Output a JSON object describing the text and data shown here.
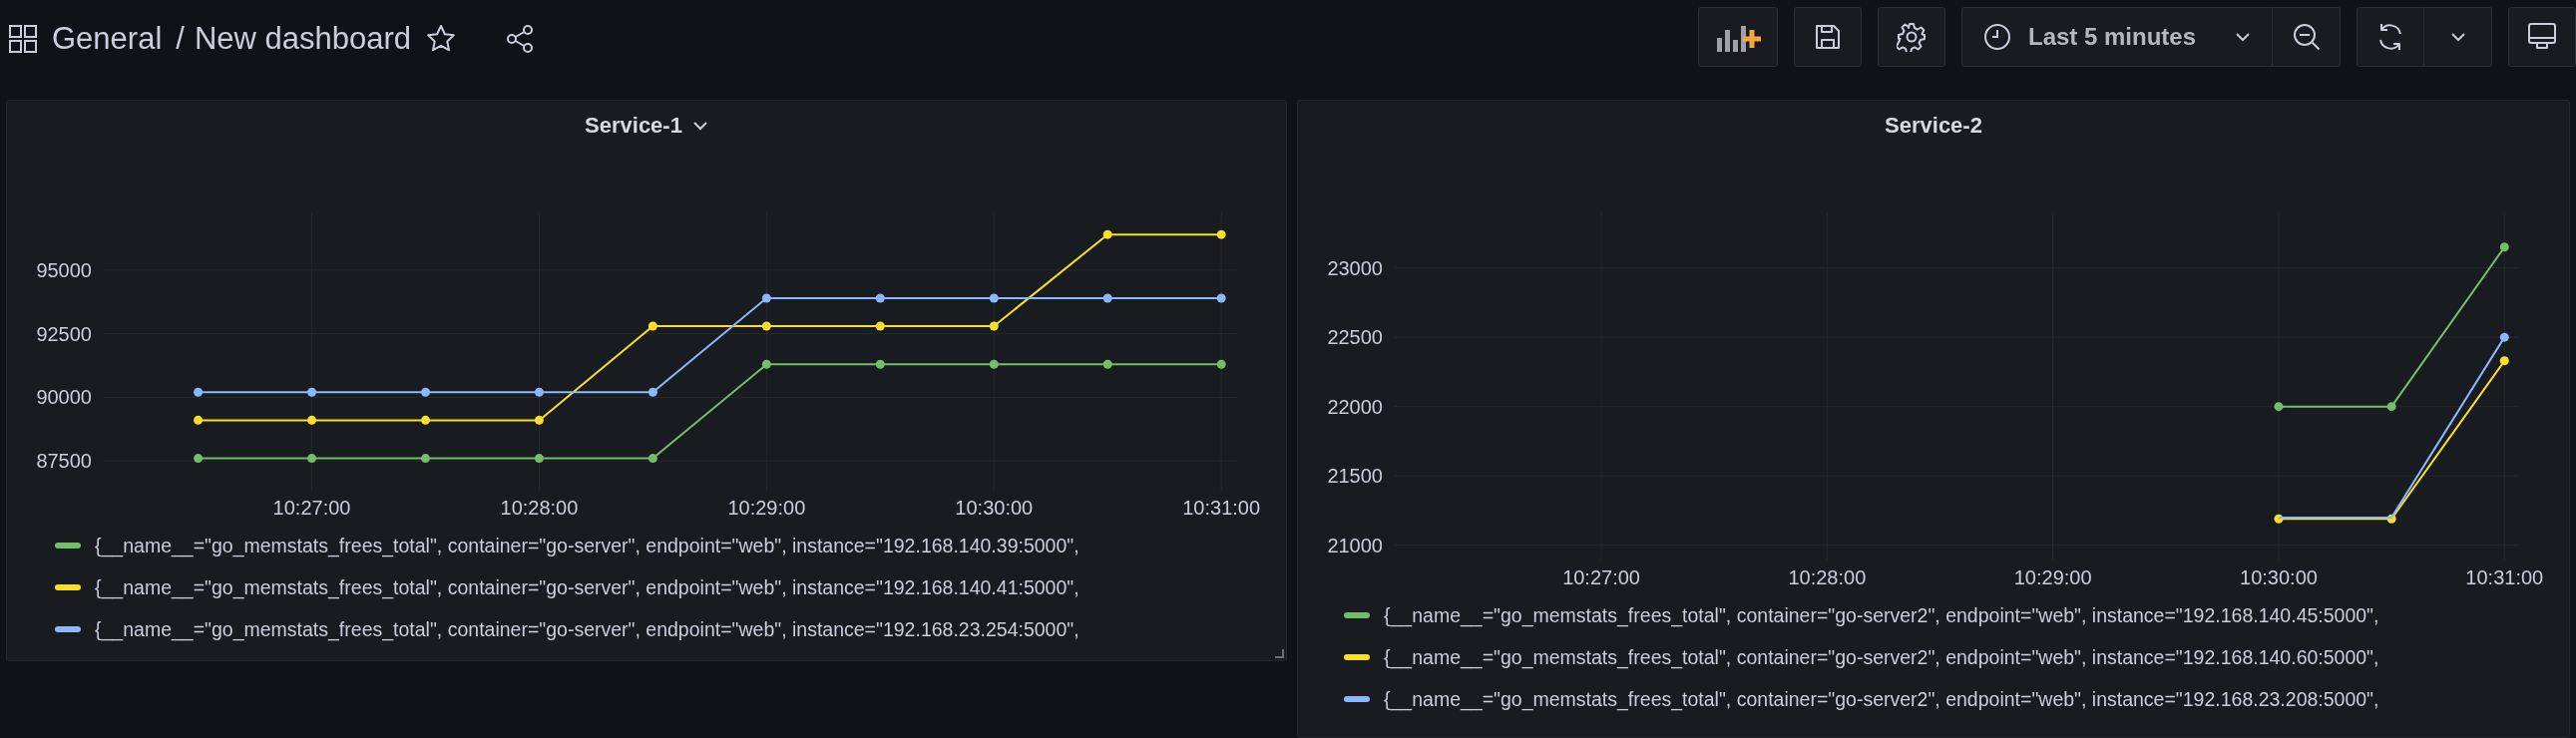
{
  "toolbar": {
    "folder": "General",
    "separator": "/",
    "title": "New dashboard",
    "starred": false,
    "time_range": "Last 5 minutes"
  },
  "panels": [
    {
      "title": "Service-1",
      "has_menu": true,
      "resizable": true,
      "chart_data": {
        "type": "line",
        "categories": [
          null,
          "10:27:00",
          null,
          "10:28:00",
          null,
          "10:29:00",
          null,
          "10:30:00",
          null,
          "10:31:00"
        ],
        "ylim": [
          86330,
          97270
        ],
        "grid": true,
        "yticks": [
          87500,
          90000,
          92500,
          95000
        ],
        "series": [
          {
            "name": "{__name__=\"go_memstats_frees_total\", container=\"go-server\", endpoint=\"web\", instance=\"192.168.140.39:5000\",",
            "color": "#73bf69",
            "marker": true,
            "values": [
              87600,
              87600,
              87600,
              87600,
              87600,
              91300,
              91300,
              91300,
              91300,
              91300
            ]
          },
          {
            "name": "{__name__=\"go_memstats_frees_total\", container=\"go-server\", endpoint=\"web\", instance=\"192.168.140.41:5000\",",
            "color": "#fade2a",
            "marker": true,
            "values": [
              89100,
              89100,
              89100,
              89100,
              92800,
              92800,
              92800,
              92800,
              96400,
              96400
            ]
          },
          {
            "name": "{__name__=\"go_memstats_frees_total\", container=\"go-server\", endpoint=\"web\", instance=\"192.168.23.254:5000\",",
            "color": "#8ab8ff",
            "marker": true,
            "values": [
              90200,
              90200,
              90200,
              90200,
              90200,
              93900,
              93900,
              93900,
              93900,
              93900
            ]
          }
        ]
      }
    },
    {
      "title": "Service-2",
      "has_menu": false,
      "resizable": false,
      "chart_data": {
        "type": "line",
        "categories": [
          null,
          "10:27:00",
          null,
          "10:28:00",
          null,
          "10:29:00",
          null,
          "10:30:00",
          null,
          "10:31:00"
        ],
        "ylim": [
          20890,
          23400
        ],
        "grid": true,
        "yticks": [
          21000,
          21500,
          22000,
          22500,
          23000
        ],
        "series": [
          {
            "name": "{__name__=\"go_memstats_frees_total\", container=\"go-server2\", endpoint=\"web\", instance=\"192.168.140.45:5000\",",
            "color": "#73bf69",
            "marker": true,
            "values": [
              null,
              null,
              null,
              null,
              null,
              null,
              null,
              22000,
              22000,
              23150
            ]
          },
          {
            "name": "{__name__=\"go_memstats_frees_total\", container=\"go-server2\", endpoint=\"web\", instance=\"192.168.140.60:5000\",",
            "color": "#fade2a",
            "marker": true,
            "values": [
              null,
              null,
              null,
              null,
              null,
              null,
              null,
              21190,
              21190,
              22330
            ]
          },
          {
            "name": "{__name__=\"go_memstats_frees_total\", container=\"go-server2\", endpoint=\"web\", instance=\"192.168.23.208:5000\",",
            "color": "#8ab8ff",
            "marker": true,
            "values": [
              null,
              null,
              null,
              null,
              null,
              null,
              null,
              21200,
              21200,
              22500
            ]
          }
        ]
      }
    }
  ]
}
